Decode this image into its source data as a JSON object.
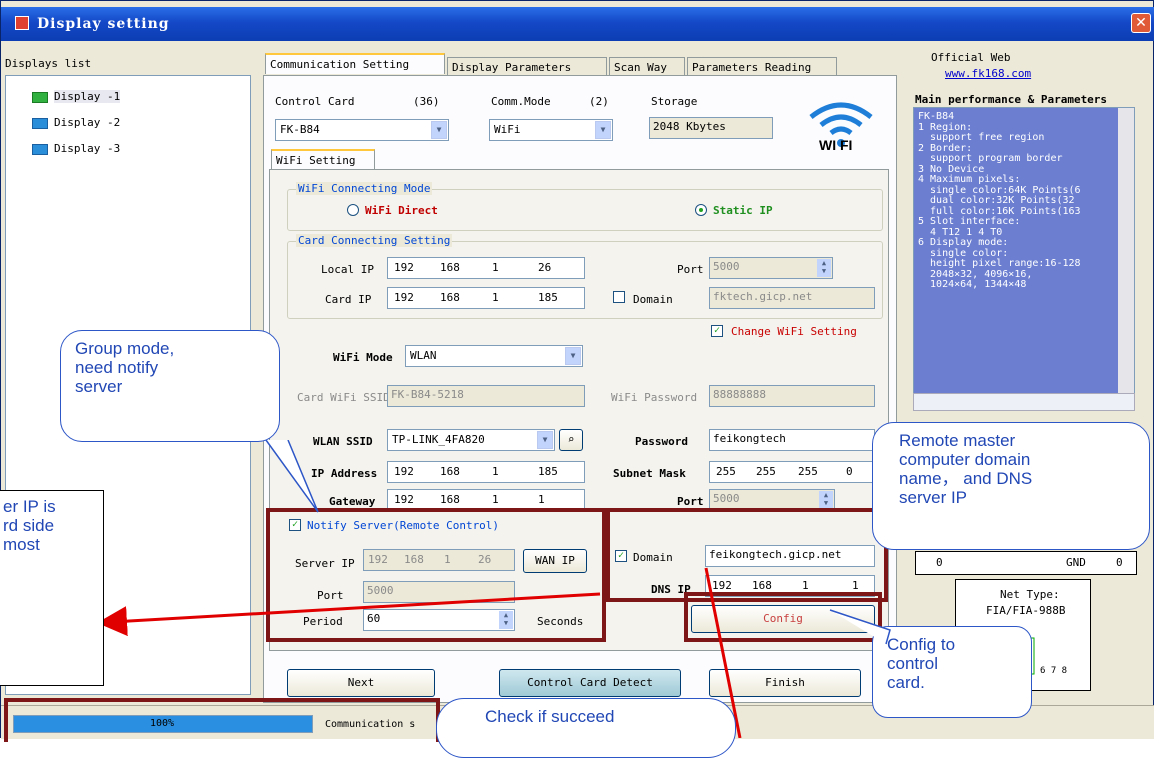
{
  "window": {
    "title": "Display setting"
  },
  "sidebar": {
    "title": "Displays list",
    "items": [
      {
        "label": "Display -1",
        "selected": true
      },
      {
        "label": "Display -2",
        "selected": false
      },
      {
        "label": "Display -3",
        "selected": false
      }
    ]
  },
  "tabs": [
    {
      "label": "Communication Setting",
      "active": true
    },
    {
      "label": "Display Parameters",
      "active": false
    },
    {
      "label": "Scan Way",
      "active": false
    },
    {
      "label": "Parameters Reading",
      "active": false
    }
  ],
  "card": {
    "control_card_label": "Control Card",
    "control_card_count": "(36)",
    "control_card_value": "FK-B84",
    "comm_mode_label": "Comm.Mode",
    "comm_mode_count": "(2)",
    "comm_mode_value": "WiFi",
    "storage_label": "Storage",
    "storage_value": "2048 Kbytes",
    "wifi_logo_text": "WI  FI"
  },
  "wifi_setting_tab": "WiFi Setting",
  "connecting_mode": {
    "title": "WiFi Connecting Mode",
    "option_direct": "WiFi Direct",
    "option_static": "Static IP",
    "selected": "Static IP"
  },
  "card_connecting": {
    "title": "Card Connecting Setting",
    "local_ip_label": "Local IP",
    "local_ip": [
      "192",
      "168",
      "1",
      "26"
    ],
    "port_label": "Port",
    "port_value": "5000",
    "card_ip_label": "Card IP",
    "card_ip": [
      "192",
      "168",
      "1",
      "185"
    ],
    "domain_label": "Domain",
    "domain_value": "fktech.gicp.net",
    "change_wifi_label": "Change WiFi Setting"
  },
  "wifi": {
    "mode_label": "WiFi Mode",
    "mode_value": "WLAN",
    "ssid_label": "Card WiFi SSID",
    "ssid_value": "FK-B84-5218",
    "password_label": "WiFi Password",
    "password_value": "88888888",
    "wlan_ssid_label": "WLAN SSID",
    "wlan_ssid_value": "TP-LINK_4FA820",
    "wlan_password_label": "Password",
    "wlan_password_value": "feikongtech",
    "ip_label": "IP Address",
    "ip_value": [
      "192",
      "168",
      "1",
      "185"
    ],
    "subnet_label": "Subnet Mask",
    "subnet_value": [
      "255",
      "255",
      "255",
      "0"
    ],
    "gateway_label": "Gateway",
    "gateway_value": [
      "192",
      "168",
      "1",
      "1"
    ],
    "port_label": "Port",
    "port_value": "5000"
  },
  "notify": {
    "checkbox_label": "Notify Server(Remote Control)",
    "server_ip_label": "Server IP",
    "server_ip": [
      "192",
      "168",
      "1",
      "26"
    ],
    "wan_ip_button": "WAN IP",
    "domain_label": "Domain",
    "domain_value": "feikongtech.gicp.net",
    "dns_ip_label": "DNS IP",
    "dns_ip": [
      "192",
      "168",
      "1",
      "1"
    ],
    "port_label": "Port",
    "port_value": "5000",
    "period_label": "Period",
    "period_value": "60",
    "seconds_label": "Seconds",
    "config_button": "Config"
  },
  "bottom_buttons": {
    "next": "Next",
    "detect": "Control Card Detect",
    "finish": "Finish"
  },
  "status": {
    "progress_text": "100%",
    "progress": 1.0,
    "message": "Communication s"
  },
  "right_panel": {
    "website_label": "Official Web",
    "website_url": "www.fk168.com",
    "params_title": "Main performance & Parameters",
    "params_lines": [
      "FK-B84",
      "1 Region:",
      "  support free region",
      "2 Border:",
      "  support program border",
      "3 No Device",
      "4 Maximum pixels:",
      "  single color:64K Points(6",
      "  dual color:32K Points(32",
      "  full color:16K Points(163",
      "5 Slot interface:",
      "  4 T12 1 4 T0",
      "6 Display mode:",
      "  single color:",
      "  height pixel range:16-128",
      "  2048×32, 4096×16,",
      "  1024×64, 1344×48"
    ],
    "table_cells": [
      "0",
      "GND",
      "0"
    ],
    "net_type_label": "Net Type:",
    "net_type_value": "FIA/FIA-988B",
    "pin_label": "6 7 8"
  },
  "callouts": {
    "group_mode": "Group mode,\nneed notify\nserver",
    "remote_master": "Remote master\ncomputer domain\nname， and DNS\nserver IP",
    "config_card": "Config to\ncontrol\ncard.",
    "check": "Check if succeed",
    "server_ip": "er IP is\nrd side\nmost"
  },
  "colors": {
    "title_bar": "#1448c6",
    "callout_text": "#2147b5",
    "red_frame": "#7d1717",
    "arrow": "#e00000"
  }
}
